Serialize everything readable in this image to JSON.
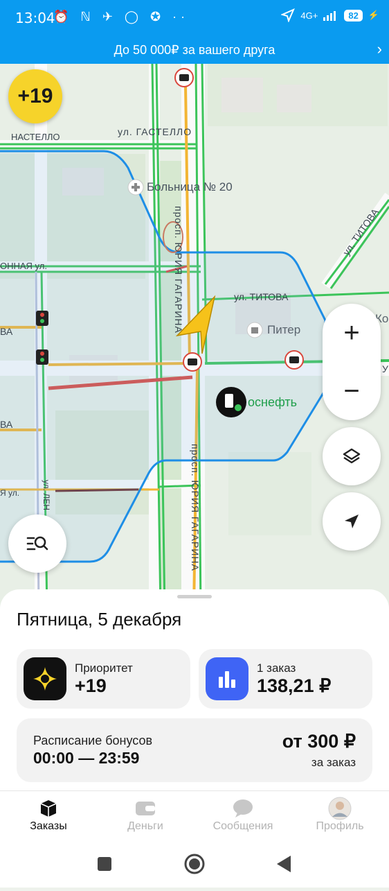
{
  "status": {
    "time": "13:04",
    "left_icons": "⏰ ℕ ✈ ◯ ✪ ··",
    "network": "4G+",
    "battery": "82"
  },
  "promo": {
    "text": "До 50 000₽ за вашего друга",
    "chevron": "›"
  },
  "map": {
    "priority_badge": "+19",
    "streets": {
      "gastello": "ул. ГАСТЕЛЛО",
      "nastello": "НАСТЕЛЛО",
      "hospital": "Больница № 20",
      "titova": "ул. ТИТОВА",
      "titova_diag": "ул. ТИТОВА",
      "gagarin_top": "просп. ЮРИЯ ГАГАРИНА",
      "gagarin_bottom": "просп. ЮРИЯ ГАГАРИНА",
      "onnaya": "ОННАЯ ул.",
      "va_1": "ВА",
      "va_2": "ВА",
      "ya_ul": "Я ул.",
      "ul_len": "ул. ЛЕН",
      "piter": "Питер",
      "rosneft": "оснефть",
      "ko": "Ко",
      "u_right": "У"
    },
    "zoom_in": "+",
    "zoom_out": "−",
    "layers_icon": "layers-icon",
    "locate_icon": "locate-icon"
  },
  "sheet": {
    "date": "Пятница, 5 декабря",
    "priority": {
      "label": "Приоритет",
      "value": "+19"
    },
    "orders": {
      "label": "1 заказ",
      "value": "138,21 ₽"
    },
    "bonus": {
      "title": "Расписание бонусов",
      "time": "00:00 — 23:59",
      "amount": "от 300 ₽",
      "per": "за заказ"
    }
  },
  "nav": {
    "orders": "Заказы",
    "money": "Деньги",
    "messages": "Сообщения",
    "profile": "Профиль"
  },
  "colors": {
    "status_blue": "#0a9bf0",
    "zone_blue": "#1e8ee6",
    "traffic_green": "#3cc45a",
    "traffic_yellow": "#f2b534",
    "traffic_red": "#d9473d",
    "priority_yellow": "#f6d32a",
    "orders_blue": "#3f64f5"
  }
}
